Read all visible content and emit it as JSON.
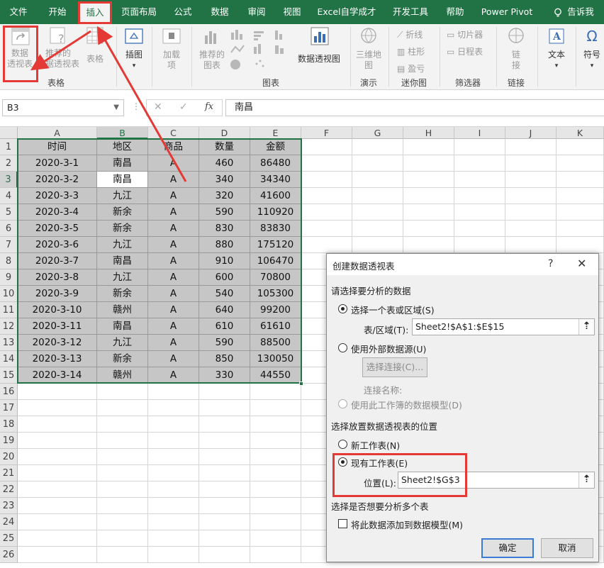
{
  "ribbon_tabs": [
    "文件",
    "开始",
    "插入",
    "页面布局",
    "公式",
    "数据",
    "审阅",
    "视图",
    "Excel自学成才",
    "开发工具",
    "帮助",
    "Power Pivot",
    "告诉我"
  ],
  "ribbon": {
    "pivot_table": "数据\n透视表",
    "recommended_pivot": "推荐的\n数据透视表",
    "table": "表格",
    "illustrations": "插图",
    "addins": "加载\n项",
    "recommended_charts": "推荐的\n图表",
    "pivot_chart": "数据透视图",
    "map_3d": "三维地\n图",
    "sparkline_line": "折线",
    "sparkline_column": "柱形",
    "sparkline_winloss": "盈亏",
    "slicer": "切片器",
    "timeline": "日程表",
    "link": "链\n接",
    "text": "文本",
    "symbols": "符号",
    "groups": {
      "tables": "表格",
      "charts": "图表",
      "tours": "演示",
      "sparklines": "迷你图",
      "filters": "筛选器",
      "links": "链接"
    }
  },
  "formula_bar": {
    "name_box": "B3",
    "formula": "南昌"
  },
  "grid": {
    "columns": [
      "A",
      "B",
      "C",
      "D",
      "E",
      "F",
      "G",
      "H",
      "I",
      "J",
      "K"
    ],
    "row_numbers": [
      "1",
      "2",
      "3",
      "4",
      "5",
      "6",
      "7",
      "8",
      "9",
      "10",
      "11",
      "12",
      "13",
      "14",
      "15",
      "16",
      "17",
      "18",
      "19",
      "20",
      "21",
      "22",
      "23",
      "24",
      "25",
      "26"
    ],
    "header": [
      "时间",
      "地区",
      "商品",
      "数量",
      "金额"
    ],
    "rows": [
      [
        "2020-3-1",
        "南昌",
        "A",
        "460",
        "86480"
      ],
      [
        "2020-3-2",
        "南昌",
        "A",
        "340",
        "34340"
      ],
      [
        "2020-3-3",
        "九江",
        "A",
        "320",
        "41600"
      ],
      [
        "2020-3-4",
        "新余",
        "A",
        "590",
        "110920"
      ],
      [
        "2020-3-5",
        "新余",
        "A",
        "830",
        "83830"
      ],
      [
        "2020-3-6",
        "九江",
        "A",
        "880",
        "175120"
      ],
      [
        "2020-3-7",
        "南昌",
        "A",
        "910",
        "106470"
      ],
      [
        "2020-3-8",
        "九江",
        "A",
        "600",
        "70800"
      ],
      [
        "2020-3-9",
        "新余",
        "A",
        "540",
        "105300"
      ],
      [
        "2020-3-10",
        "赣州",
        "A",
        "640",
        "99200"
      ],
      [
        "2020-3-11",
        "南昌",
        "A",
        "610",
        "61610"
      ],
      [
        "2020-3-12",
        "九江",
        "A",
        "590",
        "88500"
      ],
      [
        "2020-3-13",
        "新余",
        "A",
        "850",
        "130050"
      ],
      [
        "2020-3-14",
        "赣州",
        "A",
        "330",
        "44550"
      ]
    ]
  },
  "dialog": {
    "title": "创建数据透视表",
    "help": "?",
    "close": "✕",
    "section_select_data": "请选择要分析的数据",
    "opt_table_range": "选择一个表或区域(S)",
    "range_label": "表/区域(T):",
    "range_value": "Sheet2!$A$1:$E$15",
    "opt_external": "使用外部数据源(U)",
    "choose_connection": "选择连接(C)...",
    "connection_name": "连接名称:",
    "opt_data_model": "使用此工作簿的数据模型(D)",
    "section_location": "选择放置数据透视表的位置",
    "opt_new_sheet": "新工作表(N)",
    "opt_existing_sheet": "现有工作表(E)",
    "location_label": "位置(L):",
    "location_value": "Sheet2!$G$3",
    "section_multi": "选择是否想要分析多个表",
    "add_to_model": "将此数据添加到数据模型(M)",
    "ok": "确定",
    "cancel": "取消"
  },
  "colors": {
    "excel_green": "#217346",
    "annotation_red": "#e53935",
    "selection_fill": "#c6c6c6"
  }
}
